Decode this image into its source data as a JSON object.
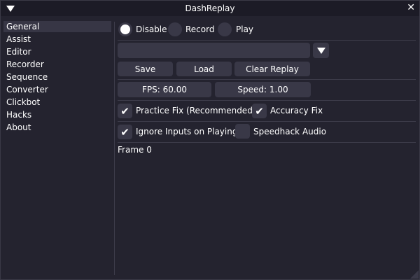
{
  "window": {
    "title": "DashReplay",
    "close_glyph": "✕"
  },
  "sidebar": {
    "items": [
      {
        "label": "General"
      },
      {
        "label": "Assist"
      },
      {
        "label": "Editor"
      },
      {
        "label": "Recorder"
      },
      {
        "label": "Sequence"
      },
      {
        "label": "Converter"
      },
      {
        "label": "Clickbot"
      },
      {
        "label": "Hacks"
      },
      {
        "label": "About"
      }
    ],
    "selected": "General"
  },
  "mode": {
    "options": [
      "Disable",
      "Record",
      "Play"
    ],
    "selected": "Disable"
  },
  "replay_input": {
    "value": ""
  },
  "buttons": {
    "save": "Save",
    "load": "Load",
    "clear": "Clear Replay"
  },
  "fps": "FPS: 60.00",
  "speed": "Speed: 1.00",
  "checks": [
    {
      "label": "Practice Fix (Recommended)",
      "checked": true
    },
    {
      "label": "Accuracy Fix",
      "checked": true
    },
    {
      "label": "Ignore Inputs on Playing",
      "checked": true
    },
    {
      "label": "Speedhack Audio",
      "checked": false
    }
  ],
  "status": "Frame 0"
}
